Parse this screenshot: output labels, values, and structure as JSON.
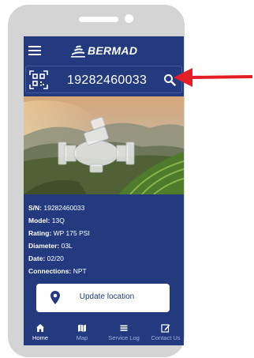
{
  "app": {
    "brand": "BERMAD"
  },
  "search": {
    "value": "19282460033"
  },
  "device": {
    "specs": [
      {
        "label": "S/N:",
        "value": "19282460033"
      },
      {
        "label": "Model:",
        "value": "13Q"
      },
      {
        "label": "Rating:",
        "value": "WP 175 PSI"
      },
      {
        "label": "Diameter:",
        "value": "03L"
      },
      {
        "label": "Date:",
        "value": "02/20"
      },
      {
        "label": "Connections:",
        "value": "NPT"
      }
    ]
  },
  "actions": {
    "update_location": "Update location"
  },
  "nav": {
    "items": [
      {
        "label": "Home",
        "icon": "home-icon",
        "active": true
      },
      {
        "label": "Map",
        "icon": "map-icon",
        "active": false
      },
      {
        "label": "Service Log",
        "icon": "list-icon",
        "active": false
      },
      {
        "label": "Contact Us",
        "icon": "edit-icon",
        "active": false
      }
    ]
  },
  "colors": {
    "primary": "#233b7e",
    "nav_inactive": "#9fb2e3",
    "phone_frame": "#d4d4d4",
    "annotation_arrow": "#e31e24"
  }
}
